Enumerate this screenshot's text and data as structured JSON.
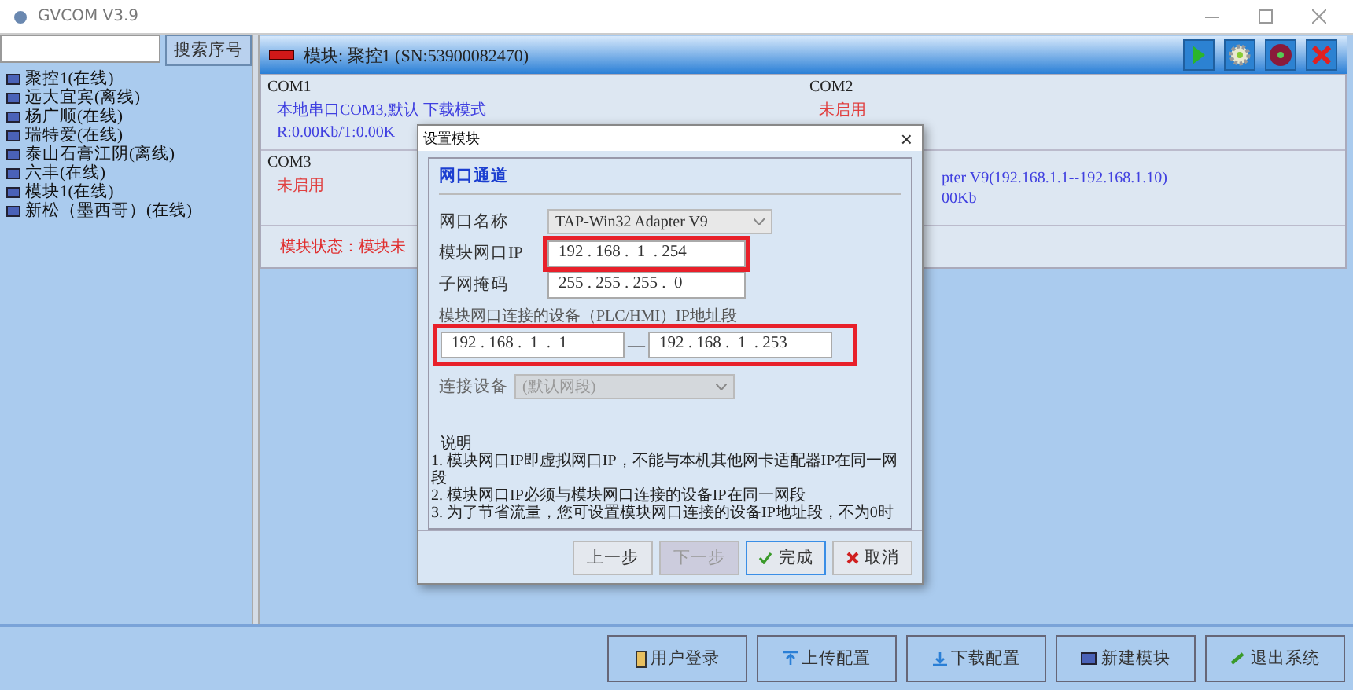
{
  "app": {
    "title": "GVCOM  V3.9"
  },
  "sidebar": {
    "search_button": "搜索序号",
    "modules": [
      {
        "label": "聚控1(在线)"
      },
      {
        "label": "远大宜宾(离线)"
      },
      {
        "label": "杨广顺(在线)"
      },
      {
        "label": "瑞特爱(在线)"
      },
      {
        "label": "泰山石膏江阴(离线)"
      },
      {
        "label": "六丰(在线)"
      },
      {
        "label": "模块1(在线)"
      },
      {
        "label": "新松（墨西哥）(在线)"
      }
    ]
  },
  "module_panel": {
    "title": "模块: 聚控1 (SN:53900082470)",
    "ports": [
      {
        "label": "COM1",
        "lines": [
          {
            "text": "本地串口COM3,默认 下载模式",
            "kind": "info"
          },
          {
            "text": "R:0.00Kb/T:0.00K",
            "kind": "info"
          }
        ]
      },
      {
        "label": "COM2",
        "lines": [
          {
            "text": "未启用",
            "kind": "disabled"
          }
        ]
      },
      {
        "label": "COM3",
        "lines": [
          {
            "text": "未启用",
            "kind": "disabled"
          }
        ]
      },
      {
        "lines": [
          {
            "text": "pter V9(192.168.1.1--192.168.1.10)",
            "kind": "info"
          },
          {
            "text": "00Kb",
            "kind": "info"
          }
        ]
      }
    ],
    "status": "模块状态：模块未"
  },
  "dialog": {
    "title": "设置模块",
    "close": "×",
    "section": "网口通道",
    "fields": [
      {
        "kind": "select",
        "label": "网口名称",
        "value": "TAP-Win32 Adapter V9",
        "highlighted": false,
        "disabled": false
      },
      {
        "kind": "ip",
        "label": "模块网口IP",
        "value": "192 . 168 .  1  . 254",
        "highlighted": true,
        "disabled": false
      },
      {
        "kind": "ip",
        "label": "子网掩码",
        "value": "255 . 255 . 255 .  0",
        "highlighted": false,
        "disabled": false
      }
    ],
    "range": {
      "label": "模块网口连接的设备（PLC/HMI）IP地址段",
      "start": "192 . 168 .  1  .  1",
      "separator": "—",
      "end": "192 . 168 .  1  . 253",
      "highlighted": true
    },
    "device": {
      "label": "连接设备",
      "value": "(默认网段)",
      "disabled": true
    },
    "notes": {
      "title": "说明",
      "lines": [
        "1. 模块网口IP即虚拟网口IP，不能与本机其他网卡适配器IP在同一网段",
        "2. 模块网口IP必须与模块网口连接的设备IP在同一网段",
        "3. 为了节省流量，您可设置模块网口连接的设备IP地址段，不为0时"
      ]
    },
    "buttons": [
      {
        "label": "上一步",
        "kind": "plain",
        "disabled": false,
        "focused": false
      },
      {
        "label": "下一步",
        "kind": "plain",
        "disabled": true,
        "focused": false
      },
      {
        "label": "完成",
        "kind": "ok",
        "disabled": false,
        "focused": true
      },
      {
        "label": "取消",
        "kind": "cancel",
        "disabled": false,
        "focused": false
      }
    ]
  },
  "footer_buttons": [
    {
      "label": "用户登录",
      "kind": "login"
    },
    {
      "label": "上传配置",
      "kind": "upload"
    },
    {
      "label": "下载配置",
      "kind": "download"
    },
    {
      "label": "新建模块",
      "kind": "new"
    },
    {
      "label": "退出系统",
      "kind": "exit"
    }
  ]
}
